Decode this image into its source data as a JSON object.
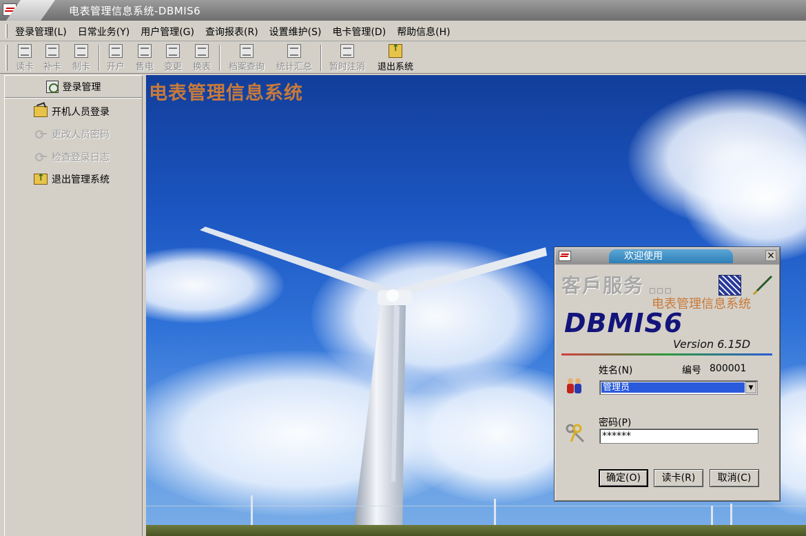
{
  "window": {
    "title": "电表管理信息系统-DBMIS6"
  },
  "menu": [
    {
      "label": "登录管理(L)"
    },
    {
      "label": "日常业务(Y)"
    },
    {
      "label": "用户管理(G)"
    },
    {
      "label": "查询报表(R)"
    },
    {
      "label": "设置维护(S)"
    },
    {
      "label": "电卡管理(D)"
    },
    {
      "label": "帮助信息(H)"
    }
  ],
  "toolbar": [
    {
      "label": "读卡",
      "enabled": false
    },
    {
      "label": "补卡",
      "enabled": false
    },
    {
      "label": "制卡",
      "enabled": false
    },
    {
      "label": "开户",
      "enabled": false
    },
    {
      "label": "售电",
      "enabled": false
    },
    {
      "label": "变更",
      "enabled": false
    },
    {
      "label": "换表",
      "enabled": false
    },
    {
      "label": "档案查询",
      "enabled": false
    },
    {
      "label": "统计汇总",
      "enabled": false
    },
    {
      "label": "暂时注消",
      "enabled": false
    },
    {
      "label": "退出系统",
      "enabled": true
    }
  ],
  "sidebar": {
    "header": "登录管理",
    "items": [
      {
        "label": "开机人员登录",
        "enabled": true
      },
      {
        "label": "更改人员密码",
        "enabled": false
      },
      {
        "label": "检查登录日志",
        "enabled": false
      },
      {
        "label": "退出管理系统",
        "enabled": true
      }
    ]
  },
  "main": {
    "banner": "电表管理信息系统"
  },
  "dialog": {
    "title": "欢迎使用",
    "service_text": "客戶服务",
    "boxes": "□□□",
    "org_name": "电表管理信息系统",
    "brand": "DBMIS6",
    "version": "Version  6.15D",
    "name_label": "姓名(N)",
    "id_label": "编号",
    "id_value": "800001",
    "name_value": "管理员",
    "password_label": "密码(P)",
    "password_value": "******",
    "buttons": {
      "ok": "确定(O)",
      "read_card": "读卡(R)",
      "cancel": "取消(C)"
    }
  },
  "colors": {
    "accent_banner": "#c87a3a",
    "brand_navy": "#14157a",
    "selection_blue": "#2a5adc"
  }
}
